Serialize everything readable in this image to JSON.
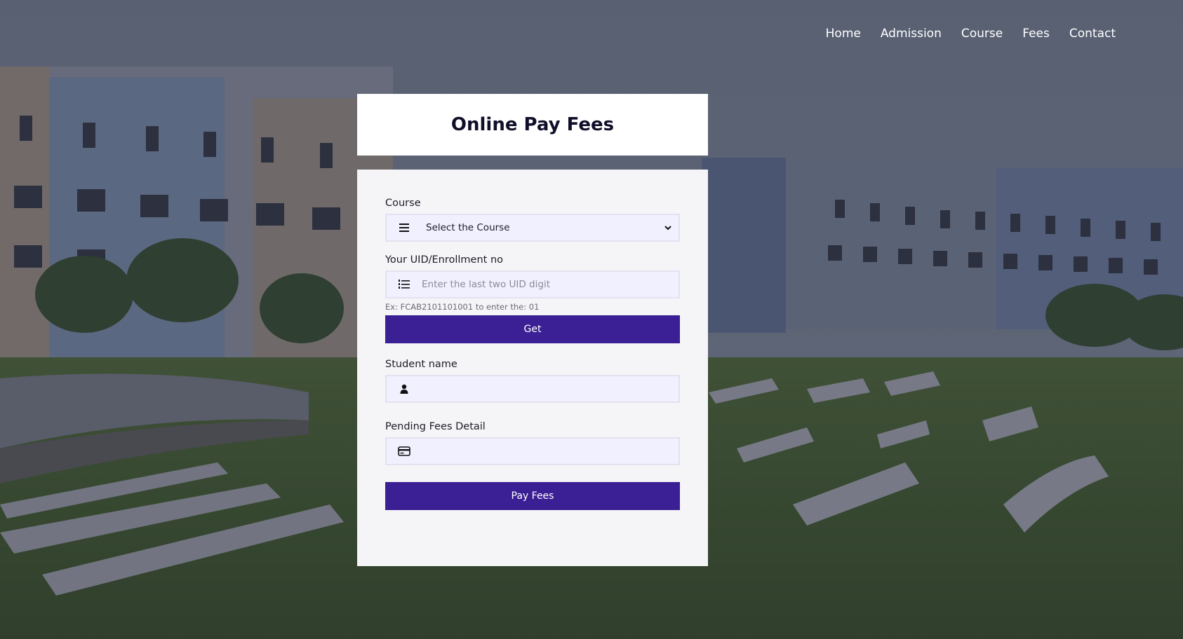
{
  "nav": {
    "items": [
      "Home",
      "Admission",
      "Course",
      "Fees",
      "Contact"
    ]
  },
  "title": "Online Pay Fees",
  "form": {
    "course": {
      "label": "Course",
      "selected": "Select the Course",
      "icon": "bars-icon"
    },
    "uid": {
      "label": "Your UID/Enrollment no",
      "placeholder": "Enter the last two UID digit",
      "hint": "Ex: FCAB2101101001 to enter the: 01",
      "icon": "list-ol-icon"
    },
    "get_button": "Get",
    "student_name": {
      "label": "Student name",
      "value": "",
      "icon": "user-icon"
    },
    "pending_fees": {
      "label": "Pending Fees Detail",
      "value": "",
      "icon": "credit-card-icon"
    },
    "pay_button": "Pay Fees"
  },
  "colors": {
    "accent": "#3b1f94",
    "input_bg": "#f1f0ff",
    "card_bg": "#f5f5f7"
  }
}
